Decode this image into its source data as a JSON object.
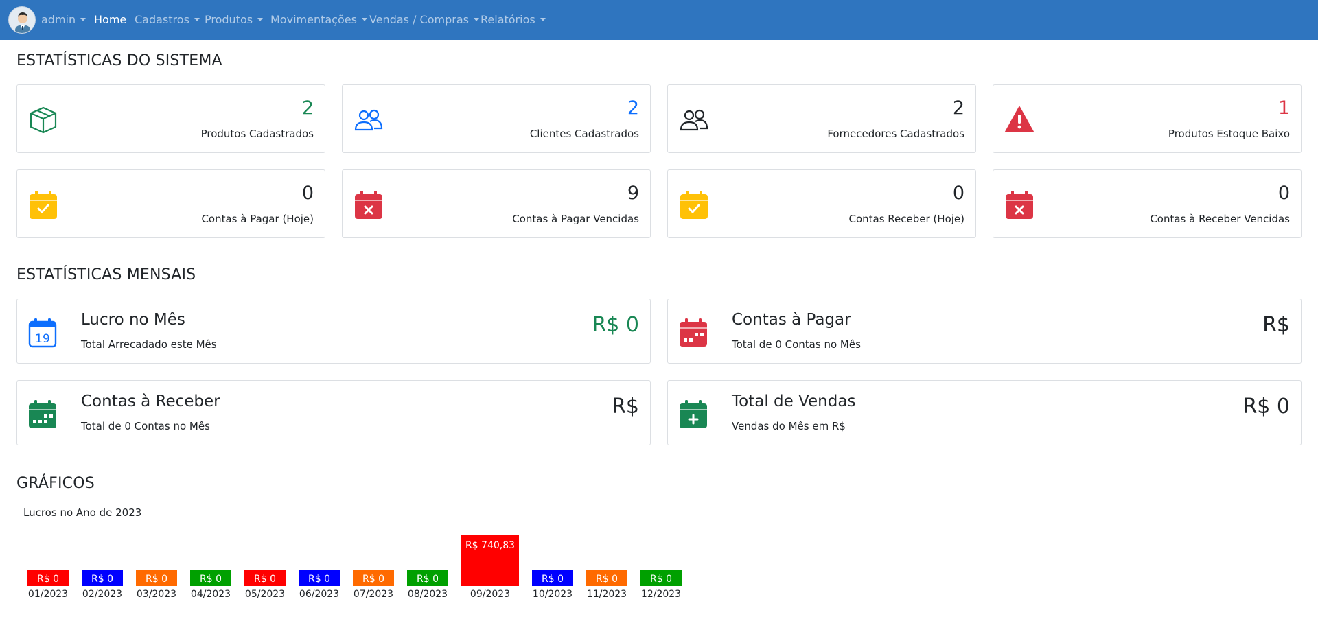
{
  "nav": {
    "user": "admin",
    "items": [
      {
        "label": "Home",
        "active": true,
        "dropdown": false
      },
      {
        "label": "Cadastros",
        "active": false,
        "dropdown": true
      },
      {
        "label": "Produtos",
        "active": false,
        "dropdown": true
      },
      {
        "label": "Movimentações",
        "active": false,
        "dropdown": true
      },
      {
        "label": "Vendas / Compras",
        "active": false,
        "dropdown": true
      },
      {
        "label": "Relatórios",
        "active": false,
        "dropdown": true
      }
    ]
  },
  "stats_title": "ESTATÍSTICAS DO SISTEMA",
  "stats": [
    {
      "value": "2",
      "label": "Produtos Cadastrados",
      "icon": "box-icon",
      "color": "#198754"
    },
    {
      "value": "2",
      "label": "Clientes Cadastrados",
      "icon": "people-icon",
      "color": "#0d6efd"
    },
    {
      "value": "2",
      "label": "Fornecedores Cadastrados",
      "icon": "people-icon",
      "color": "#212529"
    },
    {
      "value": "1",
      "label": "Produtos Estoque Baixo",
      "icon": "warning-icon",
      "color": "#dc3545"
    },
    {
      "value": "0",
      "label": "Contas à Pagar (Hoje)",
      "icon": "calendar-check-icon",
      "color": "#212529"
    },
    {
      "value": "9",
      "label": "Contas à Pagar Vencidas",
      "icon": "calendar-x-icon",
      "color": "#212529"
    },
    {
      "value": "0",
      "label": "Contas Receber (Hoje)",
      "icon": "calendar-check-icon",
      "color": "#212529"
    },
    {
      "value": "0",
      "label": "Contas à Receber Vencidas",
      "icon": "calendar-x-icon",
      "color": "#212529"
    }
  ],
  "monthly_title": "ESTATÍSTICAS MENSAIS",
  "monthly": [
    {
      "title": "Lucro no Mês",
      "subtitle": "Total Arrecadado este Mês",
      "value": "R$ 0",
      "icon": "calendar-19-icon",
      "color": "#198754"
    },
    {
      "title": "Contas à Pagar",
      "subtitle": "Total de 0 Contas no Mês",
      "value": "R$",
      "icon": "calendar-red-icon",
      "color": "#212529"
    },
    {
      "title": "Contas à Receber",
      "subtitle": "Total de 0 Contas no Mês",
      "value": "R$",
      "icon": "calendar-green-icon",
      "color": "#212529"
    },
    {
      "title": "Total de Vendas",
      "subtitle": "Vendas do Mês em R$",
      "value": "R$ 0",
      "icon": "calendar-plus-icon",
      "color": "#212529"
    }
  ],
  "charts_title": "GRÁFICOS",
  "chart_data": {
    "type": "bar",
    "title": "Lucros no Ano de 2023",
    "categories": [
      "01/2023",
      "02/2023",
      "03/2023",
      "04/2023",
      "05/2023",
      "06/2023",
      "07/2023",
      "08/2023",
      "09/2023",
      "10/2023",
      "11/2023",
      "12/2023"
    ],
    "values": [
      0,
      0,
      0,
      0,
      0,
      0,
      0,
      0,
      740.83,
      0,
      0,
      0
    ],
    "data_labels": [
      "R$ 0",
      "R$ 0",
      "R$ 0",
      "R$ 0",
      "R$ 0",
      "R$ 0",
      "R$ 0",
      "R$ 0",
      "R$ 740,83",
      "R$ 0",
      "R$ 0",
      "R$ 0"
    ],
    "colors": [
      "#ff0000",
      "#0000ff",
      "#ff6a00",
      "#00a000",
      "#ff0000",
      "#0000ff",
      "#ff6a00",
      "#00a000",
      "#ff0000",
      "#0000ff",
      "#ff6a00",
      "#00a000"
    ]
  }
}
